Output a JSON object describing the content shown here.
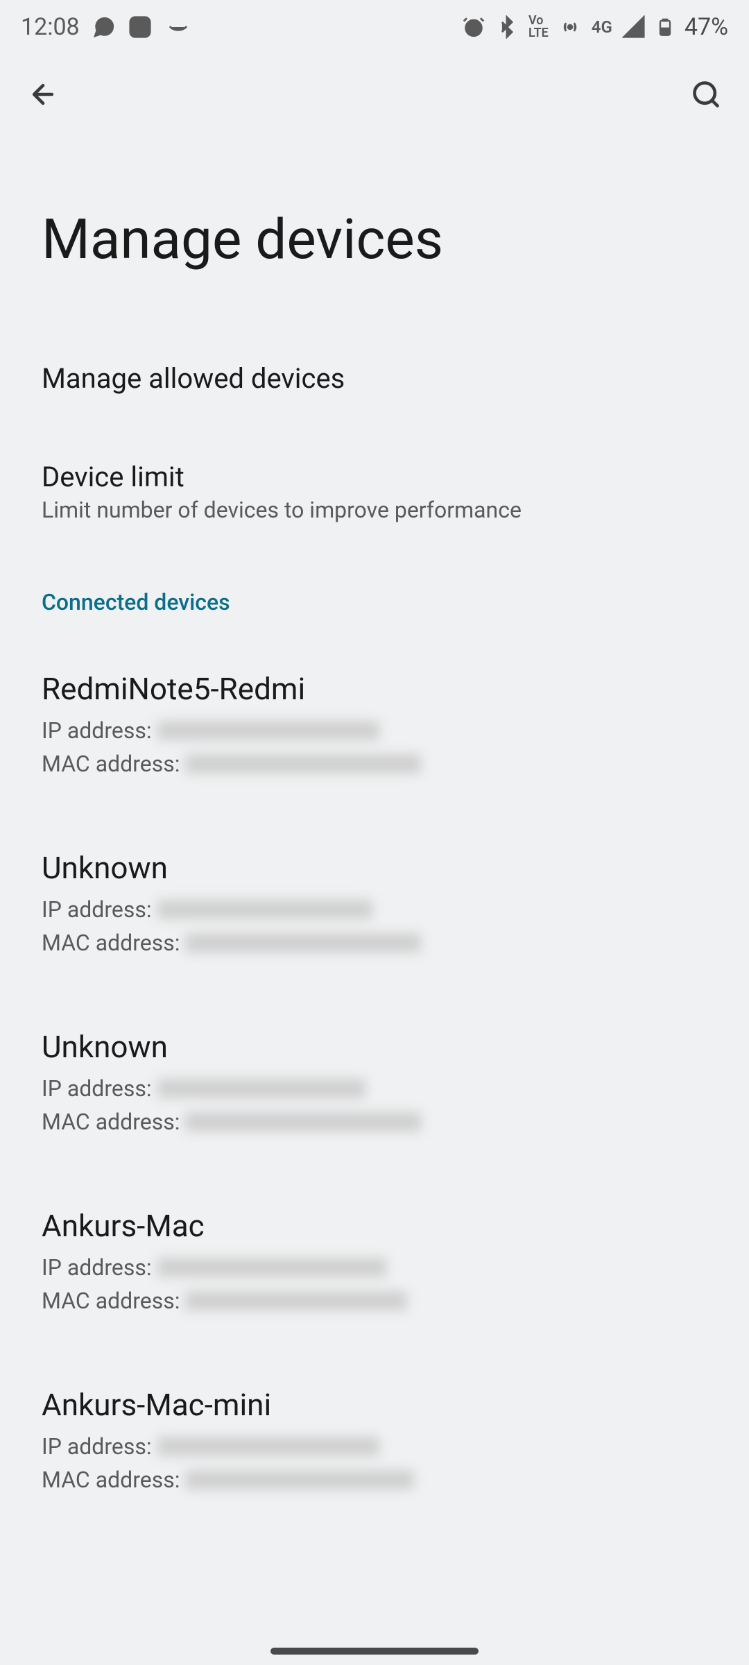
{
  "status_bar": {
    "time": "12:08",
    "network_label": "4G",
    "volte_label": "VoLTE",
    "battery": "47%"
  },
  "page": {
    "title": "Manage devices"
  },
  "settings": {
    "manage_allowed": {
      "title": "Manage allowed devices"
    },
    "device_limit": {
      "title": "Device limit",
      "subtitle": "Limit number of devices to improve performance"
    }
  },
  "section": {
    "connected_header": "Connected devices"
  },
  "devices": [
    {
      "name": "RedmiNote5-Redmi",
      "ip_label": "IP address:",
      "mac_label": "MAC address:"
    },
    {
      "name": "Unknown",
      "ip_label": "IP address:",
      "mac_label": "MAC address:"
    },
    {
      "name": "Unknown",
      "ip_label": "IP address:",
      "mac_label": "MAC address:"
    },
    {
      "name": "Ankurs-Mac",
      "ip_label": "IP address:",
      "mac_label": "MAC address:"
    },
    {
      "name": "Ankurs-Mac-mini",
      "ip_label": "IP address:",
      "mac_label": "MAC address:"
    }
  ]
}
